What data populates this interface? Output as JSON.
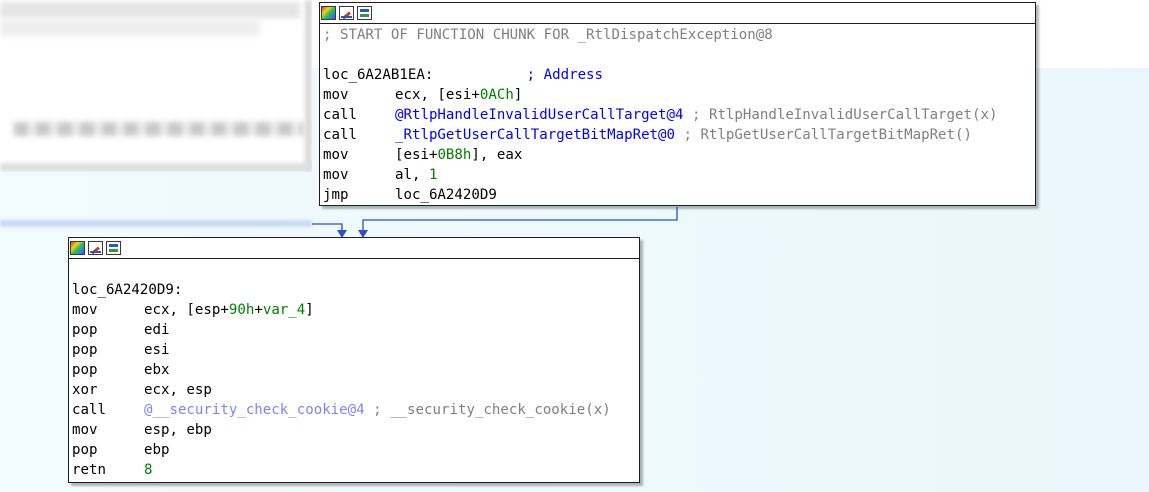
{
  "node_top": {
    "toolbar": {
      "color_icon": "color-palette-icon",
      "rename_icon": "rename-pencil-icon",
      "graph_icon": "graph-overview-icon"
    },
    "header_comment": "; START OF FUNCTION CHUNK FOR _RtlDispatchException@8",
    "label": "loc_6A2AB1EA:",
    "label_comment": "; Address",
    "lines": [
      {
        "mn": "mov",
        "a": "ecx, [esi+",
        "n": "0ACh",
        "b": "]"
      },
      {
        "mn": "call",
        "sym": "@RtlpHandleInvalidUserCallTarget@4",
        "cmt": " ; RtlpHandleInvalidUserCallTarget(x)"
      },
      {
        "mn": "call",
        "sym": "_RtlpGetUserCallTargetBitMapRet@0",
        "cmt": " ; RtlpGetUserCallTargetBitMapRet()"
      },
      {
        "mn": "mov",
        "a": "[esi+",
        "n": "0B8h",
        "b": "], eax"
      },
      {
        "mn": "mov",
        "a": "al, ",
        "n": "1"
      },
      {
        "mn": "jmp",
        "a": "loc_6A2420D9"
      }
    ]
  },
  "node_bottom": {
    "label": "loc_6A2420D9:",
    "lines": [
      {
        "mn": "mov",
        "a": "ecx, [esp+",
        "n": "90h",
        "b": "+",
        "v": "var_4",
        "c": "]"
      },
      {
        "mn": "pop",
        "a": "edi"
      },
      {
        "mn": "pop",
        "a": "esi"
      },
      {
        "mn": "pop",
        "a": "ebx"
      },
      {
        "mn": "xor",
        "a": "ecx, esp"
      },
      {
        "mn": "call",
        "sym": "@__security_check_cookie@4",
        "cmt": " ; __security_check_cookie(x)"
      },
      {
        "mn": "mov",
        "a": "esp, ebp"
      },
      {
        "mn": "pop",
        "a": "ebp"
      },
      {
        "mn": "retn",
        "n": "8"
      }
    ]
  },
  "colors": {
    "edge": "#2e4bd6",
    "background": "#eef9fd",
    "number": "#008000",
    "symbol": "#0000ff",
    "comment": "#808080"
  }
}
